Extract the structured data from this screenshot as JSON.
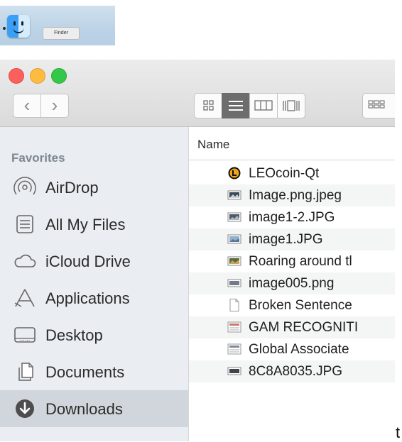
{
  "dock": {
    "tooltip": "Finder"
  },
  "toolbar": {
    "back_glyph": "‹",
    "forward_glyph": "›",
    "view_modes": [
      "icon-view",
      "list-view",
      "column-view",
      "cover-flow-view"
    ],
    "active_view": "list-view"
  },
  "sidebar": {
    "heading": "Favorites",
    "items": [
      {
        "label": "AirDrop",
        "icon": "airdrop-icon"
      },
      {
        "label": "All My Files",
        "icon": "all-my-files-icon"
      },
      {
        "label": "iCloud Drive",
        "icon": "icloud-icon"
      },
      {
        "label": "Applications",
        "icon": "applications-icon"
      },
      {
        "label": "Desktop",
        "icon": "desktop-icon"
      },
      {
        "label": "Documents",
        "icon": "documents-icon"
      },
      {
        "label": "Downloads",
        "icon": "downloads-icon",
        "selected": true
      }
    ]
  },
  "list": {
    "column_header": "Name",
    "files": [
      {
        "name": "LEOcoin-Qt",
        "icon": "app-icon"
      },
      {
        "name": "Image.png.jpeg",
        "icon": "image-icon"
      },
      {
        "name": "image1-2.JPG",
        "icon": "image-icon"
      },
      {
        "name": "image1.JPG",
        "icon": "image-icon"
      },
      {
        "name": "Roaring around tl",
        "icon": "image-icon"
      },
      {
        "name": "image005.png",
        "icon": "image-icon"
      },
      {
        "name": "Broken Sentence",
        "icon": "document-icon"
      },
      {
        "name": "GAM RECOGNITI",
        "icon": "document-icon"
      },
      {
        "name": "Global Associate",
        "icon": "document-icon"
      },
      {
        "name": "8C8A8035.JPG",
        "icon": "image-icon"
      }
    ]
  },
  "trailing_text": "t",
  "colors": {
    "close": "#fc605c",
    "minimize": "#fdbc40",
    "zoom": "#34c84a",
    "leocoin": "#f0a41a",
    "selected_sidebar": "#d1d6dc"
  }
}
